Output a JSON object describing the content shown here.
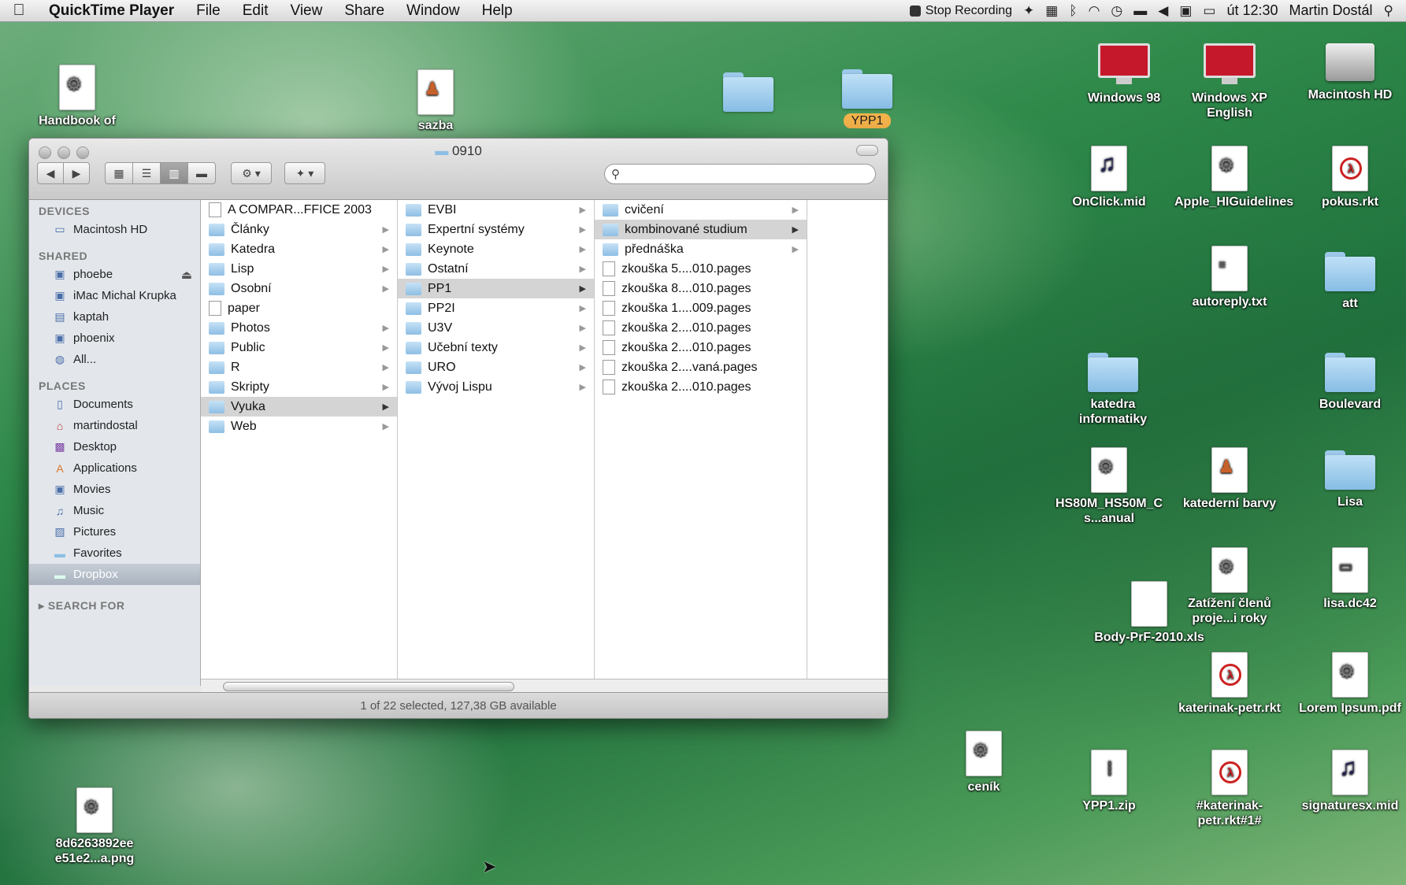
{
  "menubar": {
    "apple": "",
    "app": "QuickTime Player",
    "items": [
      "File",
      "Edit",
      "View",
      "Share",
      "Window",
      "Help"
    ],
    "recording": "Stop Recording",
    "clock": "út 12:30",
    "user": "Martin Dostál"
  },
  "desktop": {
    "handbook": "Handbook of",
    "sazba": "sazba",
    "ypp1_badge": "YPP1",
    "win98": "Windows 98",
    "winxp": "Windows XP English",
    "machd": "Macintosh HD",
    "onclick": "OnClick.mid",
    "apple_hig": "Apple_HIGuidelines",
    "pokus": "pokus.rkt",
    "autoreply": "autoreply.txt",
    "att": "att",
    "katedra": "katedra informatiky",
    "boulevard": "Boulevard",
    "hs80m": "HS80M_HS50M_C s...anual",
    "katederni": "katederní barvy",
    "lisa": "Lisa",
    "zatizeni": "Zatížení členů proje...i roky",
    "lisadc": "lisa.dc42",
    "body": "Body-PrF-2010.xls",
    "katerinak": "katerinak-petr.rkt",
    "lorem": "Lorem Ipsum.pdf",
    "cenik": "ceník",
    "ypp1zip": "YPP1.zip",
    "katerinak2": "#katerinak-petr.rkt#1#",
    "signatures": "signaturesx.mid",
    "png": "8d6263892ee e51e2...a.png"
  },
  "finder": {
    "title": "0910",
    "search_placeholder": "",
    "status": "1 of 22 selected, 127,38 GB available",
    "sidebar": {
      "devices_hdr": "DEVICES",
      "devices": [
        "Macintosh HD"
      ],
      "shared_hdr": "SHARED",
      "shared": [
        "phoebe",
        "iMac Michal Krupka",
        "kaptah",
        "phoenix",
        "All..."
      ],
      "places_hdr": "PLACES",
      "places": [
        "Documents",
        "martindostal",
        "Desktop",
        "Applications",
        "Movies",
        "Music",
        "Pictures",
        "Favorites",
        "Dropbox"
      ],
      "search_hdr": "SEARCH FOR"
    },
    "col1": [
      "A COMPAR...FFICE 2003",
      "Články",
      "Katedra",
      "Lisp",
      "Osobní",
      "paper",
      "Photos",
      "Public",
      "R",
      "Skripty",
      "Vyuka",
      "Web"
    ],
    "col2": [
      "EVBI",
      "Expertní systémy",
      "Keynote",
      "Ostatní",
      "PP1",
      "PP2I",
      "U3V",
      "Učební texty",
      "URO",
      "Vývoj Lispu"
    ],
    "col3": [
      "cvičení",
      "kombinované studium",
      "přednáška",
      "zkouška 5....010.pages",
      "zkouška 8....010.pages",
      "zkouška 1....009.pages",
      "zkouška 2....010.pages",
      "zkouška 2....010.pages",
      "zkouška 2....vaná.pages",
      "zkouška 2....010.pages"
    ]
  }
}
